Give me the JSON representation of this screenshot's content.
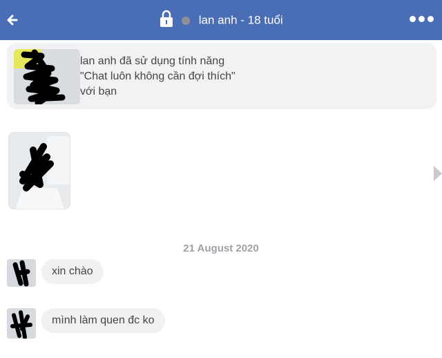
{
  "header": {
    "title": "lan anh - 18 tuổi",
    "status_color": "#8d9099",
    "background": "#4a6eb5",
    "icons": [
      "back-arrow-icon",
      "lock-icon",
      "more-dots-icon"
    ]
  },
  "system_message": {
    "line1": "lan anh đã sử dụng tính năng",
    "line2": "\"Chat luôn không cần đợi thích\"",
    "line3": "với bạn"
  },
  "conversation": {
    "date": "21 August 2020",
    "messages": [
      {
        "text": "xin chào"
      },
      {
        "text": "mình làm quen đc ko"
      }
    ]
  }
}
